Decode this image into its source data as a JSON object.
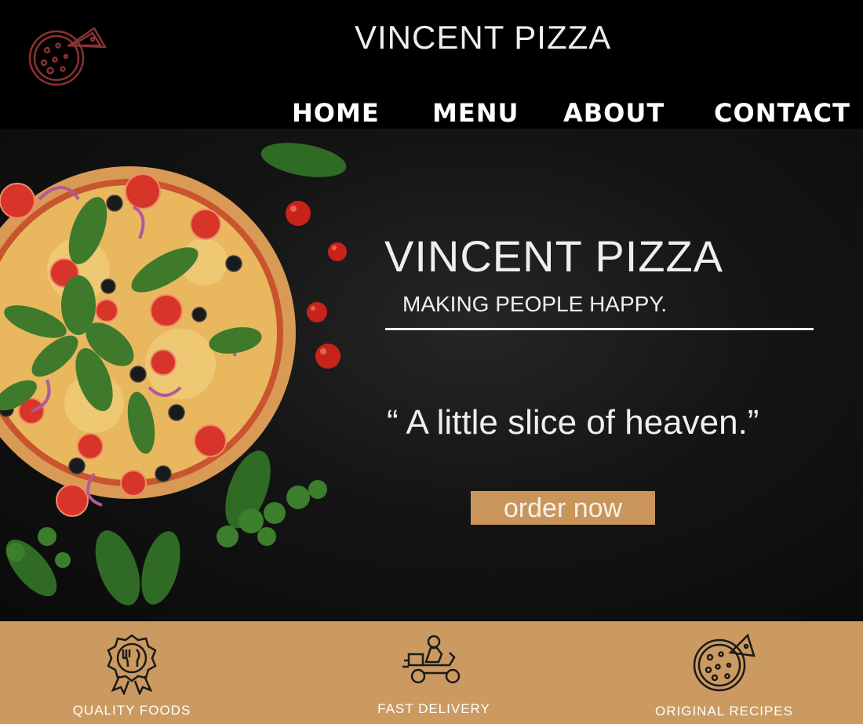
{
  "header": {
    "site_title": "VINCENT PIZZA",
    "logo_icon": "pizza-slice-icon",
    "nav": {
      "home": "HOME",
      "menu": "MENU",
      "about": "ABOUT",
      "contact": "CONTACT"
    }
  },
  "hero": {
    "title": "VINCENT PIZZA",
    "subtitle": "MAKING PEOPLE HAPPY.",
    "quote": "“ A little slice of heaven.”",
    "cta_label": "order now",
    "image": "pizza-photo"
  },
  "features": [
    {
      "label": "QUALITY FOODS",
      "icon": "quality-badge-icon"
    },
    {
      "label": "FAST DELIVERY",
      "icon": "delivery-scooter-icon"
    },
    {
      "label": "ORIGINAL RECIPES",
      "icon": "pizza-icon"
    }
  ],
  "colors": {
    "background": "#000000",
    "accent": "#cb9a60",
    "button": "#c9955a",
    "logo": "#8a2e2e"
  }
}
